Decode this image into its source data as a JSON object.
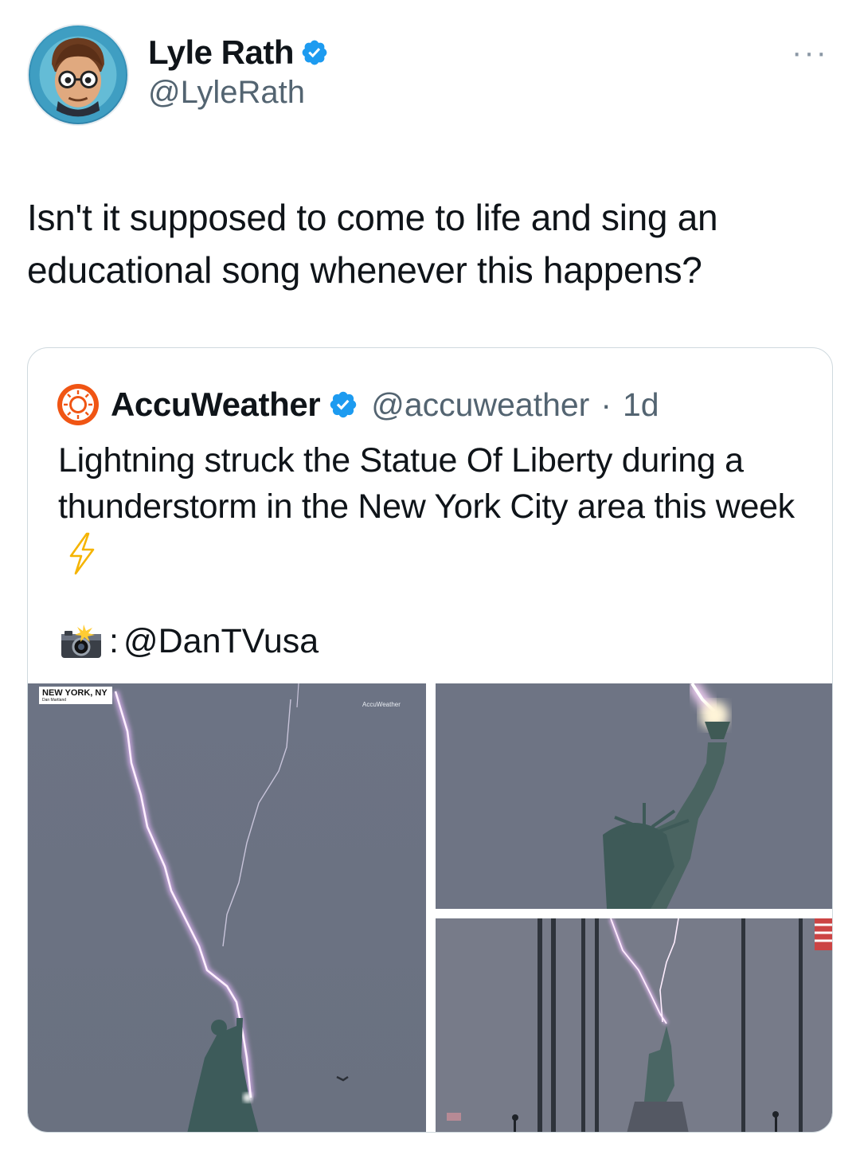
{
  "tweet": {
    "author_name": "Lyle Rath",
    "author_handle": "@LyleRath",
    "more_label": "···",
    "text": "Isn't it supposed to come to life and sing an educational song whenever this happens?"
  },
  "quote": {
    "author_name": "AccuWeather",
    "author_handle": "@accuweather",
    "separator": "·",
    "time": "1d",
    "text": "Lightning struck the Statue Of Liberty during a thunderstorm in the New York City area this week",
    "credit_separator": ":",
    "credit_handle": "@DanTVusa",
    "media": {
      "overlay_location": "NEW YORK, NY",
      "overlay_credit": "Dan Martland",
      "overlay_brand": "AccuWeather"
    }
  },
  "colors": {
    "verified_blue": "#1d9bf0",
    "accuweather_orange": "#f05514",
    "sky_gray": "#6b7282"
  },
  "icons": {
    "verified": "verified-badge-icon",
    "more": "more-icon",
    "camera": "camera-flash-icon",
    "lightning": "lightning-emoji-icon",
    "accuweather": "accuweather-logo"
  }
}
